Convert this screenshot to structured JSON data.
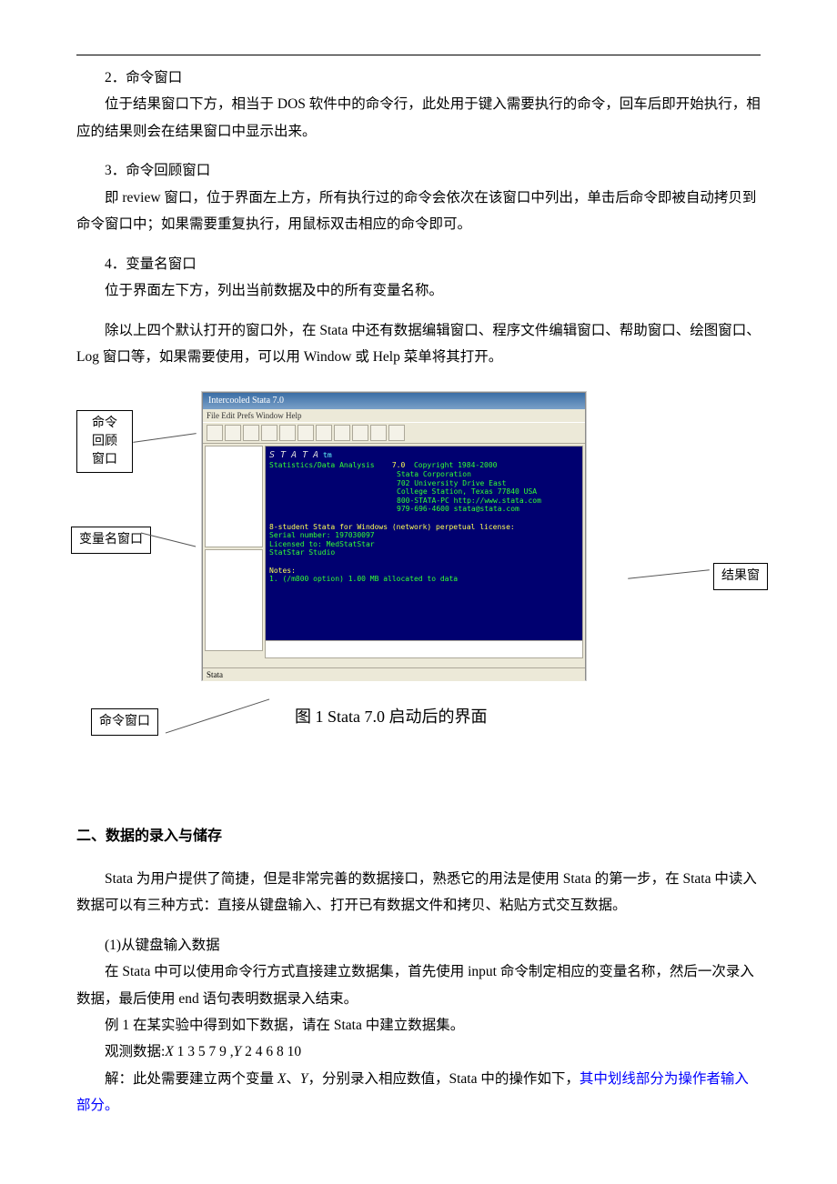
{
  "hr_line": "",
  "sections": {
    "s2": {
      "label": "2．命令窗口",
      "p1": "位于结果窗口下方，相当于 DOS 软件中的命令行，此处用于键入需要执行的命令，回车后即开始执行，相应的结果则会在结果窗口中显示出来。"
    },
    "s3": {
      "label": "3．命令回顾窗口",
      "p1": "即 review 窗口，位于界面左上方，所有执行过的命令会依次在该窗口中列出，单击后命令即被自动拷贝到命令窗口中；如果需要重复执行，用鼠标双击相应的命令即可。"
    },
    "s4": {
      "label": "4．变量名窗口",
      "p1": "位于界面左下方，列出当前数据及中的所有变量名称。"
    },
    "extra": {
      "p1": "除以上四个默认打开的窗口外，在 Stata 中还有数据编辑窗口、程序文件编辑窗口、帮助窗口、绘图窗口、Log 窗口等，如果需要使用，可以用 Window 或 Help 菜单将其打开。"
    }
  },
  "callouts": {
    "review": "命令\n回顾\n窗口",
    "var": "变量名窗口",
    "result": "结果窗",
    "cmd": "命令窗口"
  },
  "stata": {
    "title": "Intercooled Stata 7.0",
    "menus": "File  Edit  Prefs  Window  Help",
    "status": " Stata",
    "result_lines": {
      "brand": "S T A T A",
      "sub": "Statistics/Data Analysis",
      "ver": "7.0",
      "copy1": "Copyright 1984-2000",
      "copy2": "Stata Corporation",
      "addr1": "702 University Drive East",
      "addr2": "College Station, Texas 77840 USA",
      "addr3": "800-STATA-PC        http://www.stata.com",
      "addr4": "979-696-4600        stata@stata.com",
      "lic1": "8-student Stata for Windows (network) perpetual license:",
      "lic2": "       Serial number: 197030097",
      "lic3": "         Licensed to: MedStatStar",
      "lic4": "                      StatStar Studio",
      "note": "Notes:",
      "note1": "   1. (/m800 option) 1.00 MB allocated to data"
    }
  },
  "caption": "图 1    Stata 7.0 启动后的界面",
  "h2": "二、数据的录入与储存",
  "p_intro": "Stata 为用户提供了简捷，但是非常完善的数据接口，熟悉它的用法是使用 Stata 的第一步，在 Stata 中读入数据可以有三种方式：直接从键盘输入、打开已有数据文件和拷贝、粘贴方式交互数据。",
  "p_kb_label": "(1)从键盘输入数据",
  "p_kb_body": "在 Stata 中可以使用命令行方式直接建立数据集，首先使用 input 命令制定相应的变量名称，然后一次录入数据，最后使用 end 语句表明数据录入结束。",
  "ex1_label": "例 1 在某实验中得到如下数据，请在 Stata 中建立数据集。",
  "obs_prefix": "观测数据:",
  "obs_var_x": "X",
  "obs_x_vals": " 1 3 5 7 9 ",
  "obs_sep": ",",
  "obs_var_y": "Y",
  "obs_y_vals": " 2 4 6 8 10",
  "sol_prefix": "解：此处需要建立两个变量 ",
  "sol_mid1": "、",
  "sol_mid2": "，分别录入相应数值，Stata 中的操作如下，",
  "sol_blue": "其中划线部分为操作者输入部分。"
}
